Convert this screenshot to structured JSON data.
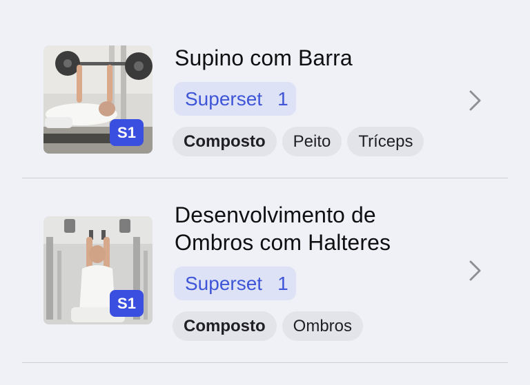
{
  "exercises": [
    {
      "title": "Supino com Barra",
      "thumbnail_tag": "S1",
      "superset_label": "Superset",
      "superset_number": "1",
      "tags": [
        "Composto",
        "Peito",
        "Tríceps"
      ]
    },
    {
      "title": "Desenvolvimento de Ombros com Halteres",
      "thumbnail_tag": "S1",
      "superset_label": "Superset",
      "superset_number": "1",
      "tags": [
        "Composto",
        "Ombros"
      ]
    }
  ],
  "icons": {
    "chevron": "chevron-right-icon"
  },
  "colors": {
    "background": "#f0f1f6",
    "superset_tag": "#3a4fe0",
    "superset_badge_bg": "#dde2f6",
    "superset_badge_text": "#3f55d8",
    "tag_bg": "#e3e4e9",
    "chevron": "#8e8e93"
  }
}
